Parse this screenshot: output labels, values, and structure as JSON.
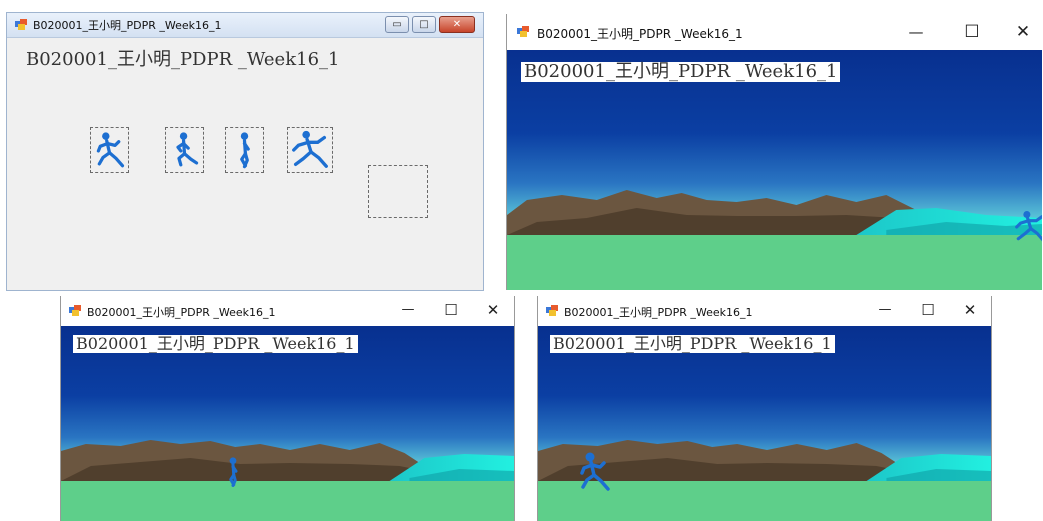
{
  "app": {
    "window_title": "B020001_王小明_PDPR _Week16_1",
    "form_label": "B020001_王小明_PDPR _Week16_1",
    "app_icon": "windows-form-icon"
  },
  "designer": {
    "controls": {
      "minimize": "▭",
      "maximize": "□",
      "close": "✕"
    },
    "sprite_frames": [
      "runner-frame-1",
      "runner-frame-2",
      "runner-frame-3",
      "runner-frame-4"
    ],
    "empty_picturebox": "picturebox-empty"
  },
  "runtime": {
    "controls": {
      "minimize": "—",
      "maximize": "☐",
      "close": "✕"
    },
    "scene": {
      "sky_top": "#08308f",
      "sky_mid": "#1f5fb8",
      "sky_horizon": "#5fc4d8",
      "mountain": "#6b5640",
      "mountain_dark": "#3f3020",
      "sea": "#1ce0d6",
      "ground": "#5ecf8a",
      "runner": "#1d6fd1"
    },
    "windows": [
      {
        "name": "run-window-1",
        "runner_pose": "runner-frame-4"
      },
      {
        "name": "run-window-2",
        "runner_pose": "runner-frame-3"
      },
      {
        "name": "run-window-3",
        "runner_pose": "runner-frame-1"
      }
    ]
  }
}
